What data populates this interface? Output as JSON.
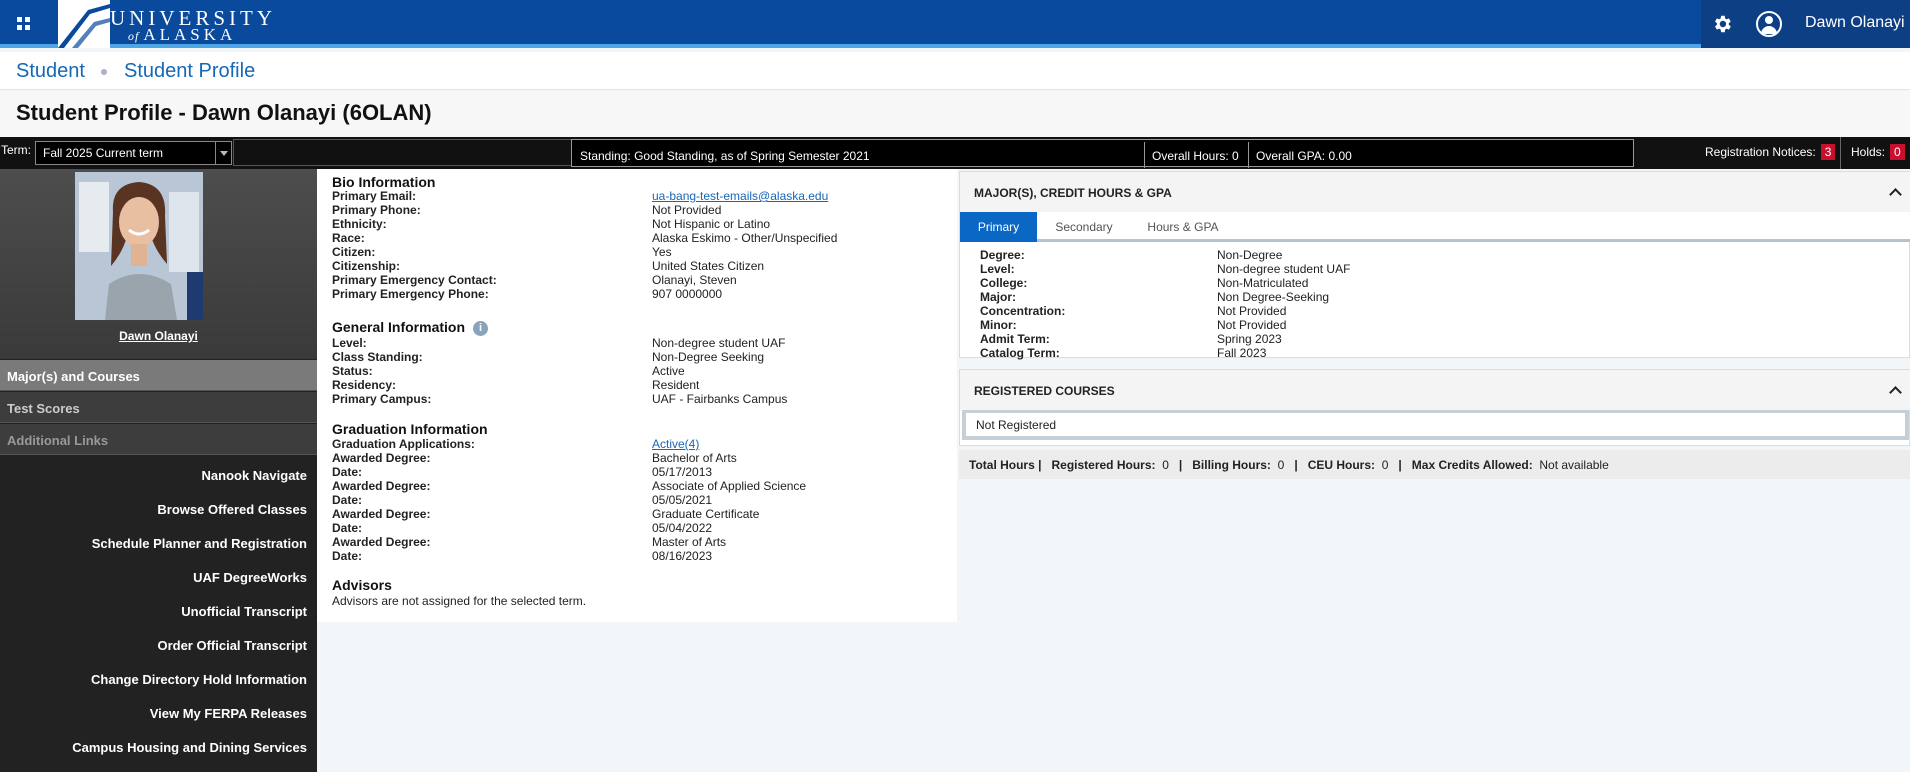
{
  "header": {
    "logo_line1": "UNIVERSITY",
    "logo_of": "of",
    "logo_line2": "ALASKA",
    "username": "Dawn Olanayi"
  },
  "breadcrumb": [
    "Student",
    "Student Profile"
  ],
  "page_title": "Student Profile - Dawn Olanayi (6OLAN)",
  "termbar": {
    "term_label": "Term:",
    "term_value": "Fall 2025 Current term",
    "standing_label": "Standing:",
    "standing_value": "Good Standing, as of Spring Semester 2021",
    "overall_hours": "Overall Hours: 0",
    "overall_gpa": "Overall GPA: 0.00",
    "registration_notices_label": "Registration Notices:",
    "registration_notices_count": "3",
    "holds_label": "Holds:",
    "holds_count": "0"
  },
  "sidebar": {
    "student_name": "Dawn Olanayi",
    "nav": [
      "Major(s) and Courses",
      "Test Scores",
      "Additional Links"
    ],
    "links": [
      "Nanook Navigate",
      "Browse Offered Classes",
      "Schedule Planner and Registration",
      "UAF DegreeWorks",
      "Unofficial Transcript",
      "Order Official Transcript",
      "Change Directory Hold Information",
      "View My FERPA Releases",
      "Campus Housing and Dining Services"
    ]
  },
  "bio": {
    "title": "Bio Information",
    "rows": [
      {
        "label": "Primary Email:",
        "value": "ua-bang-test-emails@alaska.edu"
      },
      {
        "label": "Primary Phone:",
        "value": "Not Provided"
      },
      {
        "label": "Ethnicity:",
        "value": "Not Hispanic or Latino"
      },
      {
        "label": "Race:",
        "value": "Alaska Eskimo - Other/Unspecified"
      },
      {
        "label": "Citizen:",
        "value": "Yes"
      },
      {
        "label": "Citizenship:",
        "value": "United States Citizen"
      },
      {
        "label": "Primary Emergency Contact:",
        "value": "Olanayi, Steven"
      },
      {
        "label": "Primary Emergency Phone:",
        "value": "907 0000000"
      }
    ]
  },
  "general": {
    "title": "General Information",
    "info_icon": "i",
    "rows": [
      {
        "label": "Level:",
        "value": "Non-degree student UAF"
      },
      {
        "label": "Class Standing:",
        "value": "Non-Degree Seeking"
      },
      {
        "label": "Status:",
        "value": "Active"
      },
      {
        "label": "Residency:",
        "value": "Resident"
      },
      {
        "label": "Primary Campus:",
        "value": "UAF - Fairbanks Campus"
      }
    ]
  },
  "graduation": {
    "title": "Graduation Information",
    "rows": [
      {
        "label": "Graduation Applications:",
        "value": "Active(4)"
      },
      {
        "label": "Awarded Degree:",
        "value": "Bachelor of Arts"
      },
      {
        "label": "Date:",
        "value": "05/17/2013"
      },
      {
        "label": "Awarded Degree:",
        "value": "Associate of Applied Science"
      },
      {
        "label": "Date:",
        "value": "05/05/2021"
      },
      {
        "label": "Awarded Degree:",
        "value": "Graduate Certificate"
      },
      {
        "label": "Date:",
        "value": "05/04/2022"
      },
      {
        "label": "Awarded Degree:",
        "value": "Master of Arts"
      },
      {
        "label": "Date:",
        "value": "08/16/2023"
      }
    ]
  },
  "advisors": {
    "title": "Advisors",
    "text": "Advisors are not assigned for the selected term."
  },
  "majors": {
    "title": "MAJOR(S), CREDIT HOURS & GPA",
    "tabs": [
      "Primary",
      "Secondary",
      "Hours & GPA"
    ],
    "rows": [
      {
        "label": "Degree:",
        "value": "Non-Degree"
      },
      {
        "label": "Level:",
        "value": "Non-degree student UAF"
      },
      {
        "label": "College:",
        "value": "Non-Matriculated"
      },
      {
        "label": "Major:",
        "value": "Non Degree-Seeking"
      },
      {
        "label": "Concentration:",
        "value": "Not Provided"
      },
      {
        "label": "Minor:",
        "value": "Not Provided"
      },
      {
        "label": "Admit Term:",
        "value": "Spring 2023"
      },
      {
        "label": "Catalog Term:",
        "value": "Fall 2023"
      }
    ]
  },
  "registered": {
    "title": "REGISTERED COURSES",
    "status": "Not Registered"
  },
  "totals": {
    "total_hours": "Total Hours |",
    "registered_label": "Registered Hours:",
    "registered_value": "0",
    "billing_label": "Billing Hours:",
    "billing_value": "0",
    "ceu_label": "CEU Hours:",
    "ceu_value": "0",
    "max_label": "Max Credits Allowed:",
    "max_value": "Not available",
    "sep": "|"
  }
}
